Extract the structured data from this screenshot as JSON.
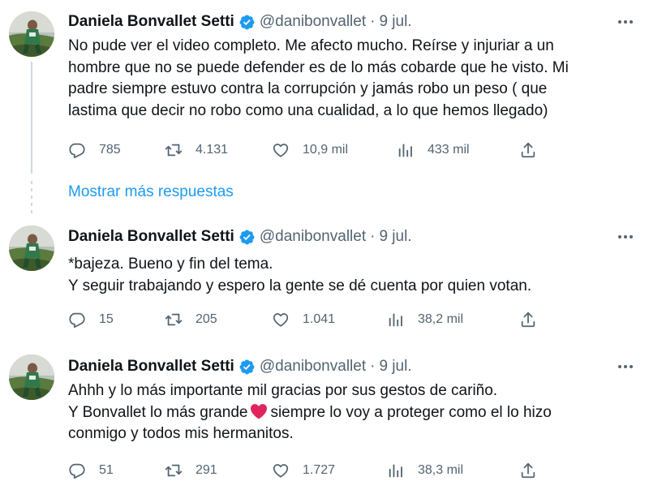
{
  "tweets": [
    {
      "name": "Daniela Bonvallet Setti",
      "handle": "@danibonvallet",
      "separator": "·",
      "date": "9 jul.",
      "lines": [
        "No pude ver el video completo. Me afecto mucho. Reírse y injuriar a un",
        "hombre que no se puede defender es de lo más cobarde que he visto. Mi",
        "padre siempre estuvo contra la corrupción y jamás robo un peso ( que",
        "lastima que decir no robo como una cualidad, a lo que hemos llegado)"
      ],
      "replies": "785",
      "retweets": "4.131",
      "likes": "10,9 mil",
      "views": "433 mil"
    },
    {
      "name": "Daniela Bonvallet Setti",
      "handle": "@danibonvallet",
      "separator": "·",
      "date": "9 jul.",
      "lines": [
        "*bajeza. Bueno y fin del tema.",
        "Y seguir trabajando y espero la gente se dé cuenta por quien votan."
      ],
      "replies": "15",
      "retweets": "205",
      "likes": "1.041",
      "views": "38,2 mil"
    },
    {
      "name": "Daniela Bonvallet Setti",
      "handle": "@danibonvallet",
      "separator": "·",
      "date": "9 jul.",
      "line1": "Ahhh y lo más importante mil gracias por sus gestos de cariño.",
      "line2_before": "Y Bonvallet lo más grande",
      "line2_after": "siempre lo voy a proteger como el lo hizo",
      "line3": "conmigo y todos mis hermanitos.",
      "replies": "51",
      "retweets": "291",
      "likes": "1.727",
      "views": "38,3 mil"
    }
  ],
  "show_more_replies": "Mostrar más respuestas",
  "icons": {
    "verified": "verified-badge-icon",
    "reply": "reply-icon",
    "retweet": "retweet-icon",
    "like": "like-icon",
    "views": "views-icon",
    "share": "share-icon",
    "more": "more-icon",
    "emoji": "red-heart-emoji"
  },
  "colors": {
    "accent": "#1d9bf0",
    "secondary_text": "#536471",
    "primary_text": "#0f1419",
    "heart_emoji": "#e0245e"
  }
}
